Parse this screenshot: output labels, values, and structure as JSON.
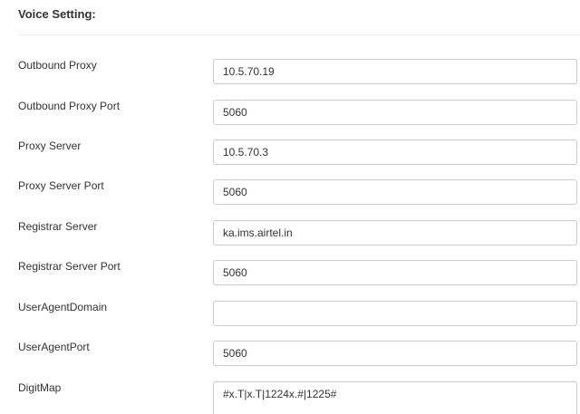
{
  "section": {
    "title": "Voice Setting:"
  },
  "fields": {
    "outbound_proxy": {
      "label": "Outbound Proxy",
      "value": "10.5.70.19"
    },
    "outbound_proxy_port": {
      "label": "Outbound Proxy Port",
      "value": "5060"
    },
    "proxy_server": {
      "label": "Proxy Server",
      "value": "10.5.70.3"
    },
    "proxy_server_port": {
      "label": "Proxy Server Port",
      "value": "5060"
    },
    "registrar_server": {
      "label": "Registrar Server",
      "value": "ka.ims.airtel.in"
    },
    "registrar_server_port": {
      "label": "Registrar Server Port",
      "value": "5060"
    },
    "user_agent_domain": {
      "label": "UserAgentDomain",
      "value": ""
    },
    "user_agent_port": {
      "label": "UserAgentPort",
      "value": "5060"
    },
    "digit_map": {
      "label": "DigitMap",
      "value": "#x.T|x.T|1224x.#|1225#"
    }
  }
}
